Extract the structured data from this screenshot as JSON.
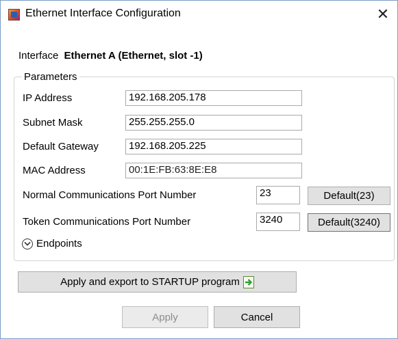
{
  "window": {
    "title": "Ethernet Interface Configuration",
    "close_glyph": "✕",
    "icon": "app-icon"
  },
  "interface": {
    "label": "Interface",
    "value": "Ethernet A (Ethernet, slot -1)"
  },
  "parameters": {
    "legend": "Parameters",
    "ip_address": {
      "label": "IP Address",
      "value": "192.168.205.178"
    },
    "subnet_mask": {
      "label": "Subnet Mask",
      "value": "255.255.255.0"
    },
    "default_gateway": {
      "label": "Default Gateway",
      "value": "192.168.205.225"
    },
    "mac_address": {
      "label": "MAC Address",
      "value": "00:1E:FB:63:8E:E8"
    },
    "normal_port": {
      "label": "Normal Communications Port Number",
      "value": "23",
      "default_button": "Default(23)"
    },
    "token_port": {
      "label": "Token Communications Port Number",
      "value": "3240",
      "default_button": "Default(3240)"
    },
    "endpoints": {
      "label": "Endpoints",
      "icon": "chevron-down-icon",
      "expanded": false
    }
  },
  "actions": {
    "export_label": "Apply and export to STARTUP program",
    "export_icon": "export-arrow-icon",
    "apply_label": "Apply",
    "apply_enabled": false,
    "cancel_label": "Cancel"
  },
  "colors": {
    "button_face": "#e1e1e1",
    "window_border": "#7a9cc6",
    "export_icon_green": "#2fa02f"
  }
}
